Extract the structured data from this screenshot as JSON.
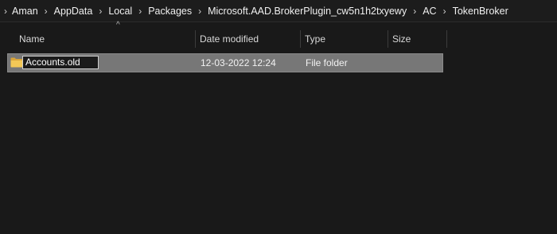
{
  "breadcrumb": {
    "items": [
      "Aman",
      "AppData",
      "Local",
      "Packages",
      "Microsoft.AAD.BrokerPlugin_cw5n1h2txyewy",
      "AC",
      "TokenBroker"
    ],
    "separator": "›"
  },
  "columns": {
    "name": "Name",
    "date_modified": "Date modified",
    "type": "Type",
    "size": "Size",
    "sort_indicator": "^"
  },
  "files": [
    {
      "name": "Accounts.old",
      "date_modified": "12-03-2022 12:24",
      "type": "File folder",
      "size": "",
      "icon": "folder-icon",
      "renaming": true
    }
  ],
  "colors": {
    "background": "#191919",
    "selected_row": "#777777",
    "folder": "#e8b84a"
  }
}
